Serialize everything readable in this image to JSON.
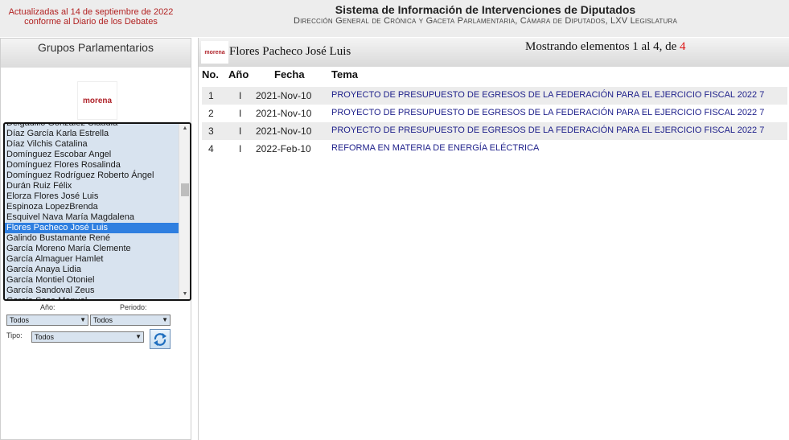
{
  "header": {
    "updated_line1": "Actualizadas al 14 de septiembre de 2022",
    "updated_line2": "conforme al Diario de los Debates",
    "title": "Sistema de Información de Intervenciones de Diputados",
    "subtitle": "Dirección General de Crónica y Gaceta Parlamentaria, Cámara de Diputados, LXV Legislatura"
  },
  "sidebar": {
    "heading": "Grupos Parlamentarios",
    "party_logo_text": "morena",
    "members": [
      "Delgadillo González Claudia",
      "Díaz García Karla Estrella",
      "Díaz Vilchis Catalina",
      "Domínguez Escobar Angel",
      "Domínguez Flores Rosalinda",
      "Domínguez Rodríguez Roberto Ángel",
      "Durán Ruiz Félix",
      "Elorza Flores José Luis",
      "Espinoza LopezBrenda",
      "Esquivel Nava María Magdalena",
      "Flores Pacheco José Luis",
      "Galindo Bustamante René",
      "García Moreno María Clemente",
      "García Almaguer Hamlet",
      "García Anaya Lidia",
      "García Montiel Otoniel",
      "García Sandoval Zeus",
      "García Sosa Manuel"
    ],
    "selected_member": "Flores Pacheco José Luis",
    "filters": {
      "year_label": "Año:",
      "year_value": "Todos",
      "period_label": "Periodo:",
      "period_value": "Todos",
      "type_label": "Tipo:",
      "type_value": "Todos"
    }
  },
  "main": {
    "logo_text": "morena",
    "deputy_name": "Flores Pacheco José Luis",
    "showing_prefix": "Mostrando elementos 1 al 4, de ",
    "showing_total": "4",
    "columns": {
      "no": "No.",
      "ano": "Año",
      "fecha": "Fecha",
      "tema": "Tema"
    },
    "rows": [
      {
        "no": "1",
        "ano": "I",
        "fecha": "2021-Nov-10",
        "tema": "PROYECTO DE PRESUPUESTO DE EGRESOS DE LA FEDERACIÓN PARA EL EJERCICIO FISCAL 2022 7"
      },
      {
        "no": "2",
        "ano": "I",
        "fecha": "2021-Nov-10",
        "tema": "PROYECTO DE PRESUPUESTO DE EGRESOS DE LA FEDERACIÓN PARA EL EJERCICIO FISCAL 2022 7"
      },
      {
        "no": "3",
        "ano": "I",
        "fecha": "2021-Nov-10",
        "tema": "PROYECTO DE PRESUPUESTO DE EGRESOS DE LA FEDERACIÓN PARA EL EJERCICIO FISCAL 2022 7"
      },
      {
        "no": "4",
        "ano": "I",
        "fecha": "2022-Feb-10",
        "tema": "REFORMA EN MATERIA DE ENERGÍA ELÉCTRICA"
      }
    ]
  },
  "icons": {
    "refresh": "refresh-icon",
    "dropdown": "chevron-down-icon"
  },
  "colors": {
    "link": "#1d1f8a",
    "updated_text": "#b22222",
    "selected_item": "#2f7fe0",
    "list_background": "#d8e3ef"
  }
}
